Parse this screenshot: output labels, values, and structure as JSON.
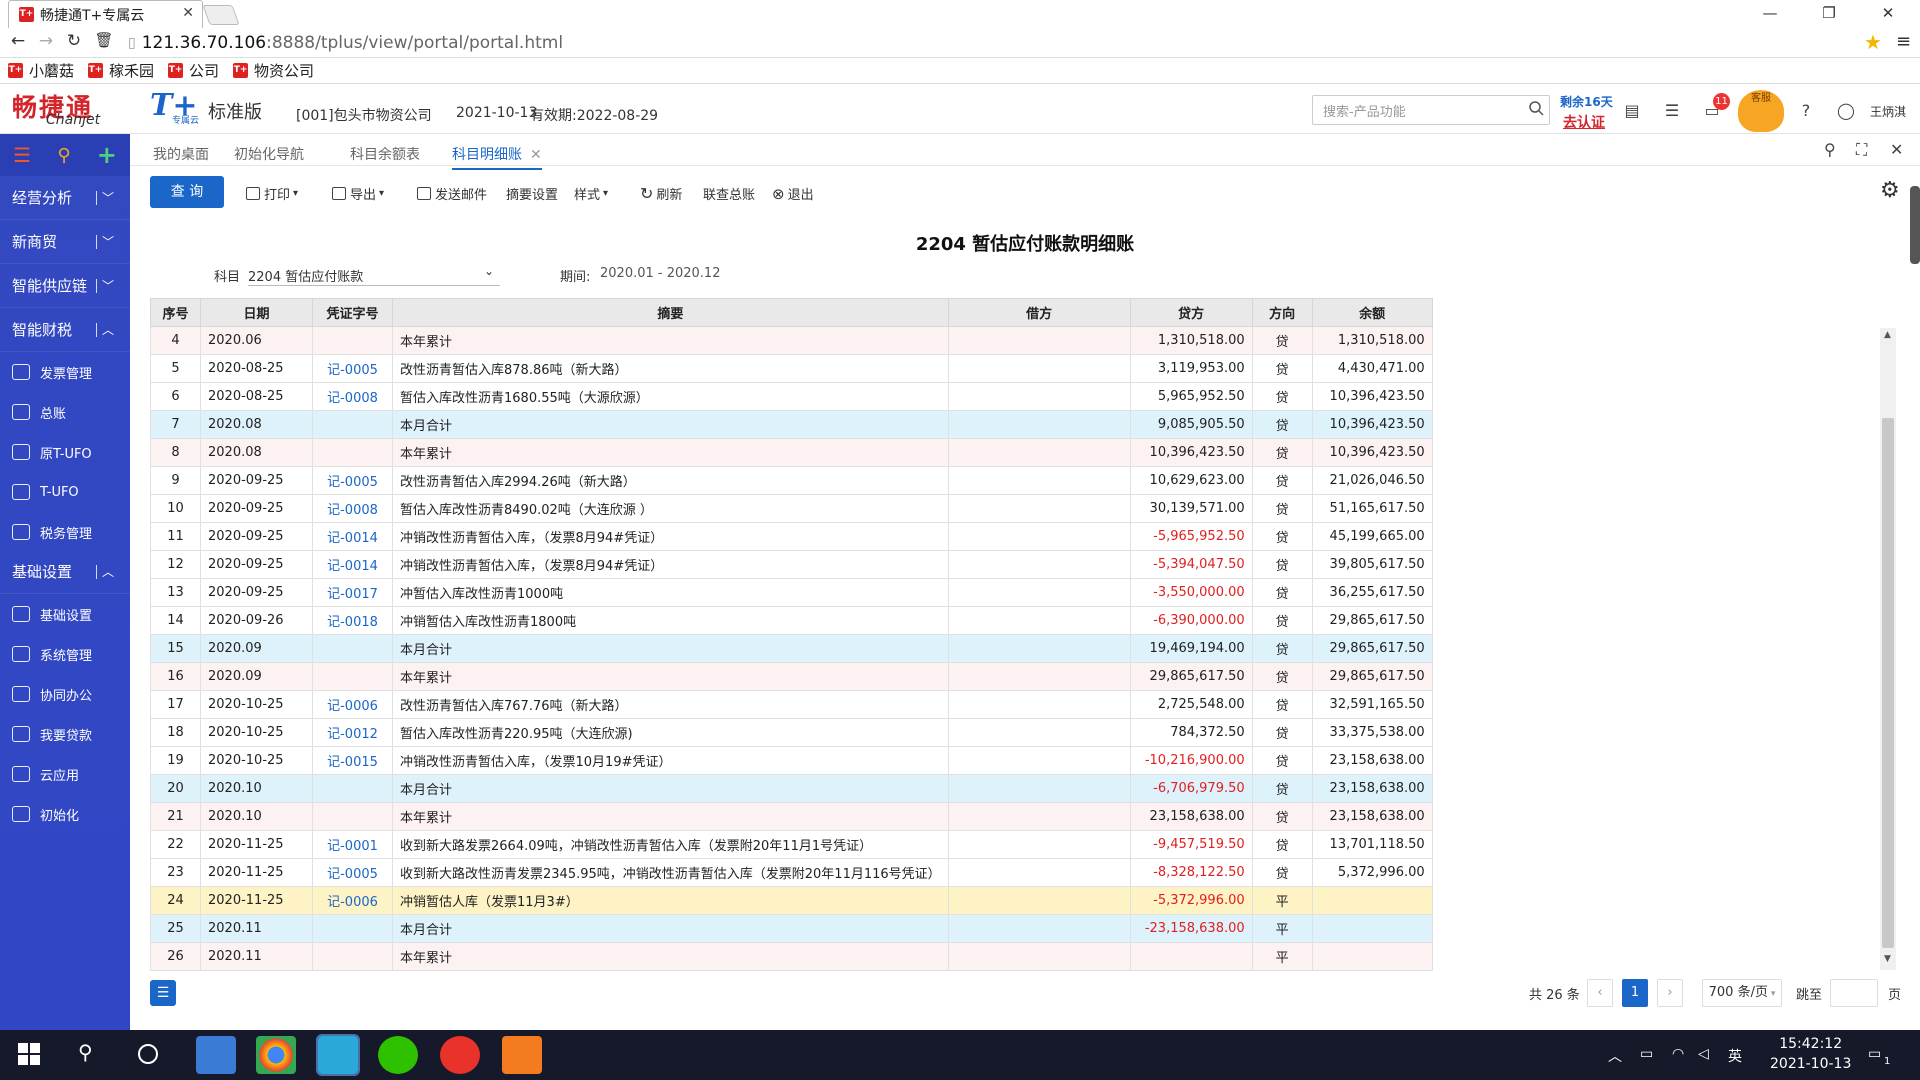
{
  "browser": {
    "tab_title": "畅捷通T+专属云",
    "favicon": "T+",
    "url_host": "121.36.70.106",
    "url_rest": ":8888/tplus/view/portal/portal.html",
    "bookmarks": [
      "小蘑菇",
      "稼禾园",
      "公司",
      "物资公司"
    ]
  },
  "header": {
    "logo_cn": "畅捷通",
    "logo_en": "Chanjet",
    "product": "T+",
    "product_sub": "专属云",
    "edition": "标准版",
    "company": "[001]包头市物资公司",
    "date": "2021-10-13",
    "expiry": "有效期:2022-08-29",
    "search_placeholder": "搜索-产品功能",
    "remain": "剩余16天",
    "certify": "去认证",
    "badge_count": "11",
    "mascot_label": "客服",
    "username": "王炳淇"
  },
  "sidebar": {
    "groups": [
      {
        "label": "经营分析",
        "expanded": false
      },
      {
        "label": "新商贸",
        "expanded": false
      },
      {
        "label": "智能供应链",
        "expanded": false
      },
      {
        "label": "智能财税",
        "expanded": true
      }
    ],
    "finance_items": [
      "发票管理",
      "总账",
      "原T-UFO",
      "T-UFO",
      "税务管理"
    ],
    "base_group": "基础设置",
    "base_items": [
      "基础设置",
      "系统管理",
      "协同办公",
      "我要贷款",
      "云应用",
      "初始化"
    ]
  },
  "tabs": [
    {
      "label": "我的桌面",
      "active": false
    },
    {
      "label": "初始化导航",
      "active": false
    },
    {
      "label": "科目余额表",
      "active": false
    },
    {
      "label": "科目明细账",
      "active": true
    }
  ],
  "toolbar": {
    "query": "查 询",
    "print": "打印",
    "export": "导出",
    "email": "发送邮件",
    "summary": "摘要设置",
    "style": "样式",
    "refresh": "刷新",
    "link": "联查总账",
    "exit": "退出"
  },
  "report": {
    "title": "2204 暂估应付账款明细账",
    "subject_label": "科目",
    "subject_value": "2204 暂估应付账款",
    "period_label": "期间:",
    "period_value": "2020.01 - 2020.12"
  },
  "table": {
    "headers": [
      "序号",
      "日期",
      "凭证字号",
      "摘要",
      "借方",
      "贷方",
      "方向",
      "余额"
    ],
    "rows": [
      {
        "no": "4",
        "date": "2020.06",
        "voucher": "",
        "summary": "本年累计",
        "debit": "",
        "credit": "1,310,518.00",
        "dir": "贷",
        "balance": "1,310,518.00",
        "style": "rpink"
      },
      {
        "no": "5",
        "date": "2020-08-25",
        "voucher": "记-0005",
        "summary": "改性沥青暂估入库878.86吨（新大路）",
        "debit": "",
        "credit": "3,119,953.00",
        "dir": "贷",
        "balance": "4,430,471.00",
        "style": "rwhite"
      },
      {
        "no": "6",
        "date": "2020-08-25",
        "voucher": "记-0008",
        "summary": "暂估入库改性沥青1680.55吨（大源欣源）",
        "debit": "",
        "credit": "5,965,952.50",
        "dir": "贷",
        "balance": "10,396,423.50",
        "style": "rwhite"
      },
      {
        "no": "7",
        "date": "2020.08",
        "voucher": "",
        "summary": "本月合计",
        "debit": "",
        "credit": "9,085,905.50",
        "dir": "贷",
        "balance": "10,396,423.50",
        "style": "rblue"
      },
      {
        "no": "8",
        "date": "2020.08",
        "voucher": "",
        "summary": "本年累计",
        "debit": "",
        "credit": "10,396,423.50",
        "dir": "贷",
        "balance": "10,396,423.50",
        "style": "rpink"
      },
      {
        "no": "9",
        "date": "2020-09-25",
        "voucher": "记-0005",
        "summary": "改性沥青暂估入库2994.26吨（新大路）",
        "debit": "",
        "credit": "10,629,623.00",
        "dir": "贷",
        "balance": "21,026,046.50",
        "style": "rwhite"
      },
      {
        "no": "10",
        "date": "2020-09-25",
        "voucher": "记-0008",
        "summary": "暂估入库改性沥青8490.02吨（大连欣源 ）",
        "debit": "",
        "credit": "30,139,571.00",
        "dir": "贷",
        "balance": "51,165,617.50",
        "style": "rwhite"
      },
      {
        "no": "11",
        "date": "2020-09-25",
        "voucher": "记-0014",
        "summary": "冲销改性沥青暂估入库，（发票8月94#凭证）",
        "debit": "",
        "credit": "-5,965,952.50",
        "dir": "贷",
        "balance": "45,199,665.00",
        "style": "rwhite"
      },
      {
        "no": "12",
        "date": "2020-09-25",
        "voucher": "记-0014",
        "summary": "冲销改性沥青暂估入库，（发票8月94#凭证）",
        "debit": "",
        "credit": "-5,394,047.50",
        "dir": "贷",
        "balance": "39,805,617.50",
        "style": "rwhite"
      },
      {
        "no": "13",
        "date": "2020-09-25",
        "voucher": "记-0017",
        "summary": "冲暂估入库改性沥青1000吨",
        "debit": "",
        "credit": "-3,550,000.00",
        "dir": "贷",
        "balance": "36,255,617.50",
        "style": "rwhite"
      },
      {
        "no": "14",
        "date": "2020-09-26",
        "voucher": "记-0018",
        "summary": "冲销暂估入库改性沥青1800吨",
        "debit": "",
        "credit": "-6,390,000.00",
        "dir": "贷",
        "balance": "29,865,617.50",
        "style": "rwhite"
      },
      {
        "no": "15",
        "date": "2020.09",
        "voucher": "",
        "summary": "本月合计",
        "debit": "",
        "credit": "19,469,194.00",
        "dir": "贷",
        "balance": "29,865,617.50",
        "style": "rblue"
      },
      {
        "no": "16",
        "date": "2020.09",
        "voucher": "",
        "summary": "本年累计",
        "debit": "",
        "credit": "29,865,617.50",
        "dir": "贷",
        "balance": "29,865,617.50",
        "style": "rpink"
      },
      {
        "no": "17",
        "date": "2020-10-25",
        "voucher": "记-0006",
        "summary": "改性沥青暂估入库767.76吨（新大路）",
        "debit": "",
        "credit": "2,725,548.00",
        "dir": "贷",
        "balance": "32,591,165.50",
        "style": "rwhite"
      },
      {
        "no": "18",
        "date": "2020-10-25",
        "voucher": "记-0012",
        "summary": "暂估入库改性沥青220.95吨（大连欣源)",
        "debit": "",
        "credit": "784,372.50",
        "dir": "贷",
        "balance": "33,375,538.00",
        "style": "rwhite"
      },
      {
        "no": "19",
        "date": "2020-10-25",
        "voucher": "记-0015",
        "summary": "冲销改性沥青暂估入库，（发票10月19#凭证）",
        "debit": "",
        "credit": "-10,216,900.00",
        "dir": "贷",
        "balance": "23,158,638.00",
        "style": "rwhite"
      },
      {
        "no": "20",
        "date": "2020.10",
        "voucher": "",
        "summary": "本月合计",
        "debit": "",
        "credit": "-6,706,979.50",
        "dir": "贷",
        "balance": "23,158,638.00",
        "style": "rblue"
      },
      {
        "no": "21",
        "date": "2020.10",
        "voucher": "",
        "summary": "本年累计",
        "debit": "",
        "credit": "23,158,638.00",
        "dir": "贷",
        "balance": "23,158,638.00",
        "style": "rpink"
      },
      {
        "no": "22",
        "date": "2020-11-25",
        "voucher": "记-0001",
        "summary": "收到新大路发票2664.09吨，冲销改性沥青暂估入库（发票附20年11月1号凭证）",
        "debit": "",
        "credit": "-9,457,519.50",
        "dir": "贷",
        "balance": "13,701,118.50",
        "style": "rwhite"
      },
      {
        "no": "23",
        "date": "2020-11-25",
        "voucher": "记-0005",
        "summary": "收到新大路改性沥青发票2345.95吨，冲销改性沥青暂估入库（发票附20年11月116号凭证）",
        "debit": "",
        "credit": "-8,328,122.50",
        "dir": "贷",
        "balance": "5,372,996.00",
        "style": "rwhite"
      },
      {
        "no": "24",
        "date": "2020-11-25",
        "voucher": "记-0006",
        "summary": "冲销暂估人库（发票11月3#）",
        "debit": "",
        "credit": "-5,372,996.00",
        "dir": "平",
        "balance": "",
        "style": "ryel"
      },
      {
        "no": "25",
        "date": "2020.11",
        "voucher": "",
        "summary": "本月合计",
        "debit": "",
        "credit": "-23,158,638.00",
        "dir": "平",
        "balance": "",
        "style": "rblue"
      },
      {
        "no": "26",
        "date": "2020.11",
        "voucher": "",
        "summary": "本年累计",
        "debit": "",
        "credit": "",
        "dir": "平",
        "balance": "",
        "style": "rpink"
      }
    ]
  },
  "pagination": {
    "total": "共 26 条",
    "current": "1",
    "per_page": "700 条/页",
    "jump": "跳至",
    "page_unit": "页"
  },
  "taskbar": {
    "ime": "英",
    "time": "15:42:12",
    "date": "2021-10-13",
    "notify_count": "1"
  },
  "colors": {
    "accent": "#1a66c9",
    "sidebar": "#3349c0",
    "negative": "#e02020",
    "brand_red": "#d4252b"
  }
}
